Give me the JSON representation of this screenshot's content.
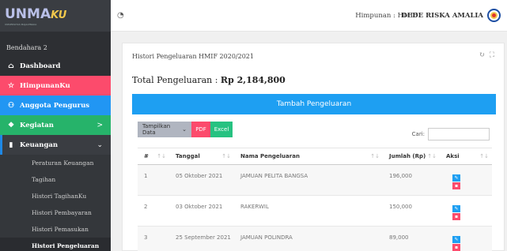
{
  "brand": {
    "logo": "UNMA",
    "logo_suffix": "KU",
    "tagline": "UNIVERSITAS MAJALENGKA"
  },
  "sidebar": {
    "role": "Bendahara 2",
    "items": [
      {
        "label": "Dashboard",
        "icon": "home-icon"
      },
      {
        "label": "HimpunanKu",
        "icon": "star-icon"
      },
      {
        "label": "Anggota Pengurus",
        "icon": "users-icon"
      },
      {
        "label": "Kegiatan",
        "icon": "layers-icon",
        "arrow": ">"
      },
      {
        "label": "Keuangan",
        "icon": "book-icon",
        "arrow": "⌄"
      }
    ],
    "subitems": [
      {
        "label": "Peraturan Keuangan"
      },
      {
        "label": "Tagihan"
      },
      {
        "label": "Histori TagihanKu"
      },
      {
        "label": "Histori Pembayaran"
      },
      {
        "label": "Histori Pemasukan"
      },
      {
        "label": "Histori Pengeluaran"
      }
    ]
  },
  "topbar": {
    "himpunan": "Himpunan : HMIF",
    "user": "DEDE RISKA AMALIA"
  },
  "card": {
    "title": "Histori Pengeluaran HMIF 2020/2021",
    "total_label": "Total Pengeluaran :",
    "total_value": "Rp 2,184,800",
    "add_button": "Tambah Pengeluaran",
    "show_data": "Tampilkan Data",
    "pdf": "PDF",
    "excel": "Excel",
    "search_label": "Cari:",
    "search_value": ""
  },
  "table": {
    "headers": [
      "#",
      "Tanggal",
      "Nama Pengeluaran",
      "Jumlah (Rp)",
      "Aksi"
    ],
    "rows": [
      {
        "no": "1",
        "tanggal": "05 Oktober 2021",
        "nama": "JAMUAN PELITA BANGSA",
        "jumlah": "196,000"
      },
      {
        "no": "2",
        "tanggal": "03 Oktober 2021",
        "nama": "RAKERWIL",
        "jumlah": "150,000"
      },
      {
        "no": "3",
        "tanggal": "25 September 2021",
        "nama": "JAMUAN POLINDRA",
        "jumlah": "89,000"
      }
    ]
  },
  "colors": {
    "accent": "#1e9ff2",
    "danger": "#fc4b6c",
    "success": "#26b36a",
    "sidebar": "#2d2f33"
  }
}
